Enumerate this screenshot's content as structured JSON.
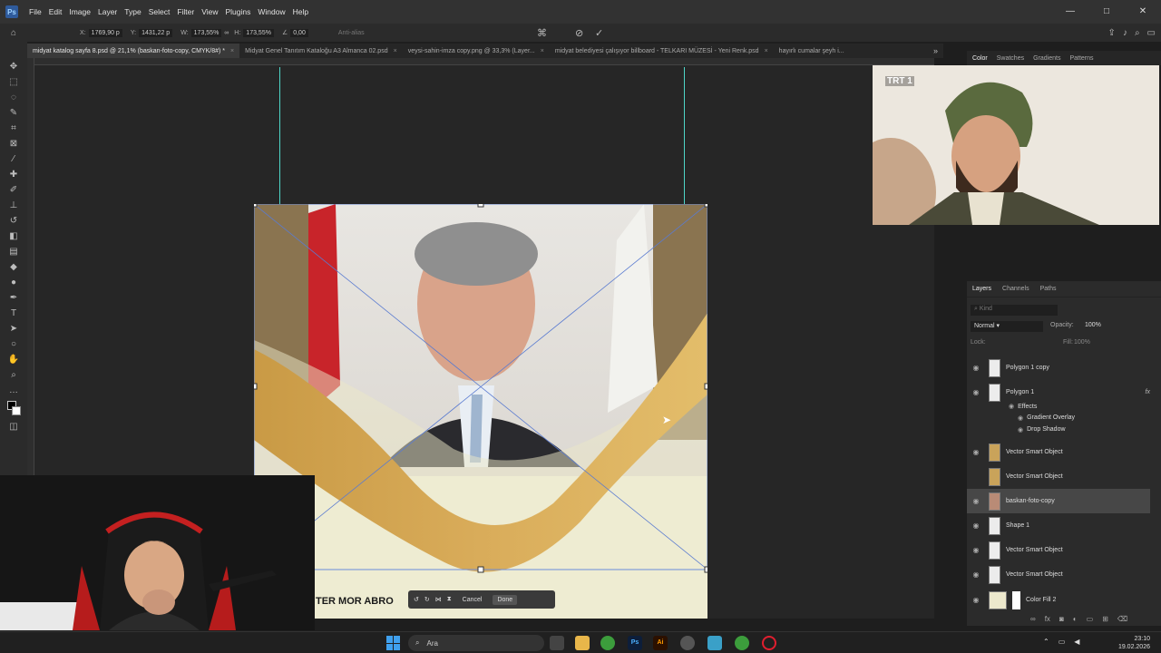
{
  "menu": {
    "items": [
      "File",
      "Edit",
      "Image",
      "Layer",
      "Type",
      "Select",
      "Filter",
      "View",
      "Plugins",
      "Window",
      "Help"
    ]
  },
  "options": {
    "x_label": "X:",
    "x_value": "1769,90 p",
    "y_label": "Y:",
    "y_value": "1431,22 p",
    "w_label": "W:",
    "w_value": "173,55%",
    "h_label": "H:",
    "h_value": "173,55%",
    "angle_value": "0,00",
    "antialias": "Anti-alias"
  },
  "tabs": [
    {
      "label": "midyat katalog sayfa 8.psd @ 21,1% (baskan-foto-copy, CMYK/8#) *",
      "active": true
    },
    {
      "label": "Midyat Genel Tanıtım Kataloğu A3 Almanca 02.psd",
      "active": false
    },
    {
      "label": "veysi-sahin-imza copy.png @ 33,3% (Layer...",
      "active": false
    },
    {
      "label": "midyat belediyesi çalışıyor billboard - TELKARI MÜZESİ - Yeni Renk.psd",
      "active": false
    },
    {
      "label": "hayırlı cumalar şeyh i...",
      "active": false
    }
  ],
  "canvas": {
    "banner_text": "TER MOR ABRO",
    "transform_buttons": {
      "cancel": "Cancel",
      "done": "Done"
    }
  },
  "color_panel": {
    "tabs": [
      "Color",
      "Swatches",
      "Gradients",
      "Patterns"
    ]
  },
  "video": {
    "channel_logo": "TRT 1"
  },
  "layers_panel": {
    "tabs": [
      "Layers",
      "Channels",
      "Paths"
    ],
    "search_placeholder": "Kind",
    "blend_mode": "Normal",
    "opacity_label": "Opacity:",
    "opacity_value": "100%",
    "lock_label": "Lock:",
    "fill_label": "Fill:",
    "fill_value": "100%",
    "layers": [
      {
        "name": "Polygon 1 copy",
        "visible": true
      },
      {
        "name": "Polygon 1",
        "visible": true,
        "fx": "fx"
      },
      {
        "name": "Effects",
        "visible": true,
        "sub": true
      },
      {
        "name": "Gradient Overlay",
        "visible": true,
        "sub": true
      },
      {
        "name": "Drop Shadow",
        "visible": true,
        "sub": true
      },
      {
        "name": "Vector Smart Object",
        "visible": true
      },
      {
        "name": "Vector Smart Object",
        "visible": false
      },
      {
        "name": "baskan-foto-copy",
        "visible": true,
        "selected": true
      },
      {
        "name": "Shape 1",
        "visible": true
      },
      {
        "name": "Vector Smart Object",
        "visible": true
      },
      {
        "name": "Vector Smart Object",
        "visible": true
      },
      {
        "name": "Color Fill 2",
        "visible": true
      }
    ]
  },
  "taskbar": {
    "search_label": "Ara",
    "time": "23:10",
    "date": "19.02.2026"
  }
}
